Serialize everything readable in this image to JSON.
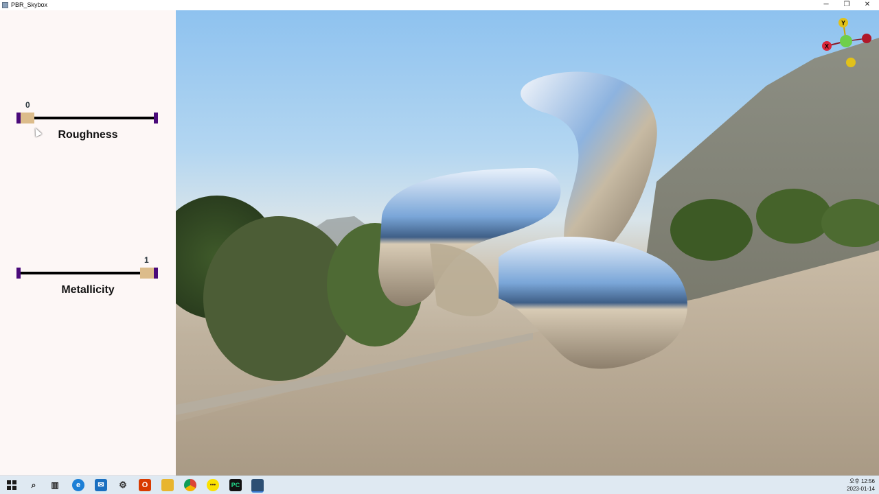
{
  "window": {
    "title": "PBR_Skybox",
    "minimize_glyph": "─",
    "maximize_glyph": "❐",
    "close_glyph": "✕"
  },
  "controls": {
    "roughness": {
      "label": "Roughness",
      "value_text": "0",
      "value": 0.0
    },
    "metallicity": {
      "label": "Metallicity",
      "value_text": "1",
      "value": 1.0
    }
  },
  "gizmo": {
    "x_label": "X",
    "y_label": "Y",
    "colors": {
      "x": "#d8263a",
      "y": "#e1c11a",
      "z": "#6fcf4a"
    }
  },
  "taskbar": {
    "icons": [
      "windows-start-icon",
      "search-icon",
      "task-view-icon",
      "edge-icon",
      "mail-icon",
      "settings-icon",
      "office-icon",
      "file-explorer-icon",
      "chrome-icon",
      "kakaotalk-icon",
      "pycharm-icon",
      "app-window-icon"
    ],
    "clock_time": "오후 12:56",
    "clock_date": "2023-01-14"
  }
}
